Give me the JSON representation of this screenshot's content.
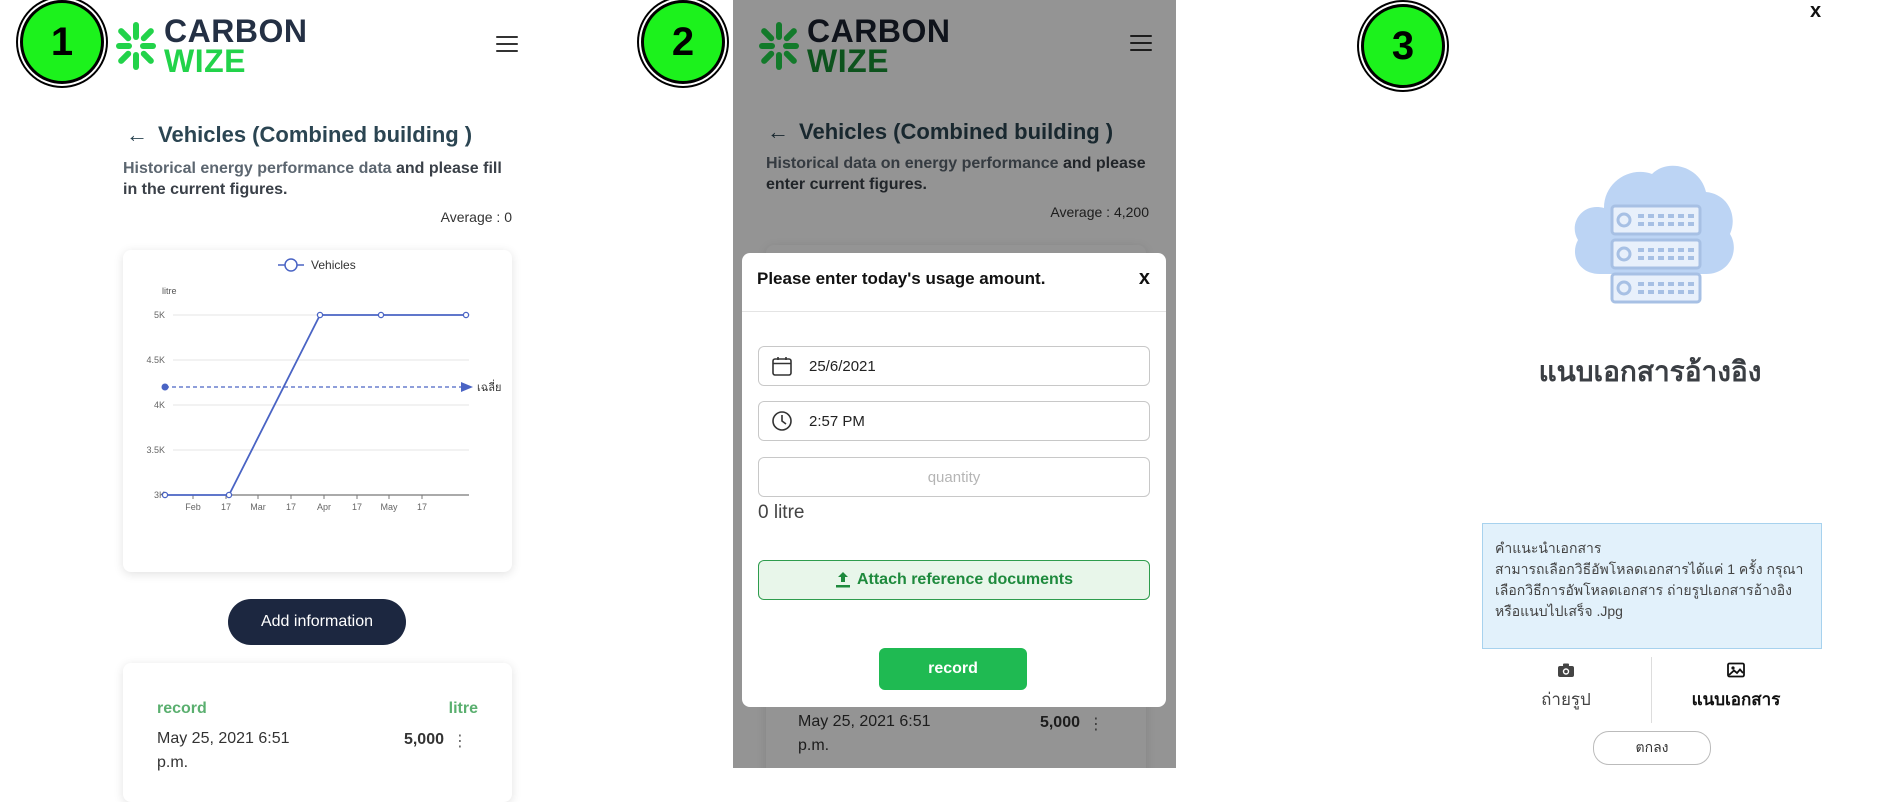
{
  "badges": [
    "1",
    "2",
    "3"
  ],
  "brand": {
    "line1": "CARBON",
    "line2": "WIZE"
  },
  "panel1": {
    "title": "Vehicles (Combined building )",
    "subtitle_normal": "Historical energy performance data",
    "subtitle_bold": " and please fill in the current figures.",
    "average": "Average : 0",
    "add_button": "Add information",
    "record_header": "record",
    "unit_header": "litre",
    "records": [
      {
        "date": "May 25, 2021 6:51",
        "date2": "p.m.",
        "value": "5,000"
      }
    ]
  },
  "chart_data": {
    "type": "line",
    "legend": "Vehicles",
    "ylabel": "litre",
    "average_label": "เฉลี่ย",
    "ytick_labels": [
      "3K",
      "3.5K",
      "4K",
      "4.5K",
      "5K"
    ],
    "xtick_labels": [
      "Feb",
      "17",
      "Mar",
      "17",
      "Apr",
      "17",
      "May",
      "17"
    ],
    "ylim": [
      3000,
      5000
    ],
    "series": [
      {
        "name": "Vehicles",
        "x": [
          "Feb 1",
          "Mar 1",
          "Apr 1",
          "May 1",
          "May 25"
        ],
        "values": [
          3000,
          3000,
          5000,
          5000,
          5000
        ],
        "color": "#4a64c4"
      }
    ],
    "average_line": 4200
  },
  "panel2": {
    "title": "Vehicles (Combined building )",
    "subtitle_normal": "Historical data on energy performance",
    "subtitle_bold": " and please enter current figures.",
    "average": "Average : 4,200",
    "records": [
      {
        "date": "May 25, 2021 6:51",
        "date2": "p.m.",
        "value": "5,000"
      }
    ],
    "modal": {
      "title": "Please enter today's usage amount.",
      "close": "x",
      "date_value": "25/6/2021",
      "time_value": "2:57 PM",
      "quantity_placeholder": "quantity",
      "unit_text": "0 litre",
      "attach_button": "Attach reference documents",
      "record_button": "record"
    }
  },
  "panel3": {
    "close": "x",
    "title": "แนบเอกสารอ้างอิง",
    "note_heading": "คำแนะนำเอกสาร",
    "note_body": "สามารถเลือกวิธีอัพโหลดเอกสารได้แค่ 1 ครั้ง กรุณาเลือกวิธีการอัพโหลดเอกสาร ถ่ายรูปเอกสารอ้างอิง หรือแนบไปเสร็จ .Jpg",
    "option_photo": "ถ่ายรูป",
    "option_attach": "แนบเอกสาร",
    "ok_button": "ตกลง"
  },
  "colors": {
    "brand_green": "#22d34a",
    "badge_green": "#1cf21c",
    "record_green": "#1fba52",
    "dark_button": "#1c2740",
    "line_blue": "#4a64c4"
  }
}
